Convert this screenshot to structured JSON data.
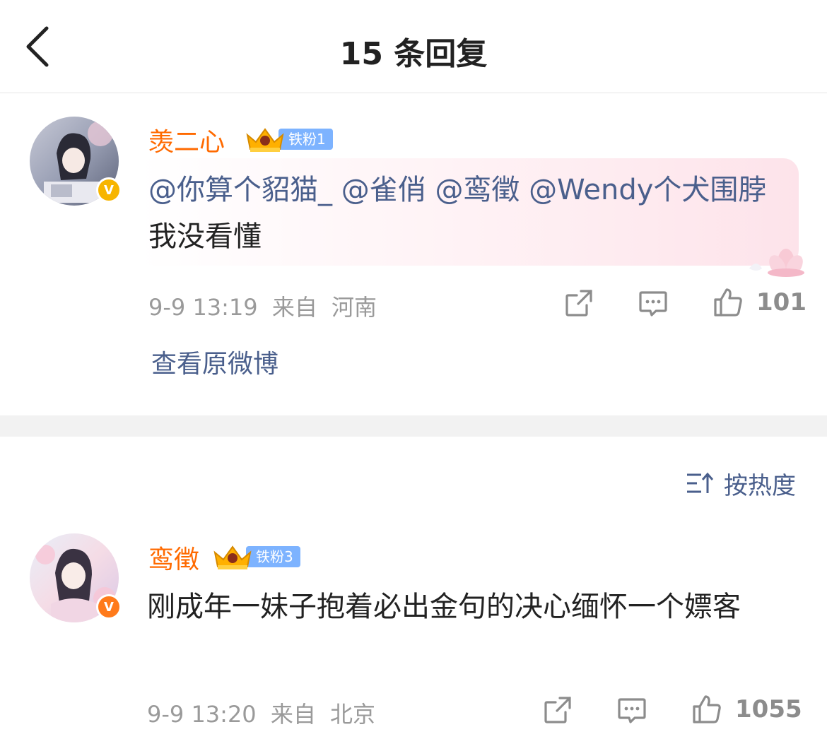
{
  "header": {
    "title": "15 条回复",
    "back_icon": "chevron-left-icon"
  },
  "original_comment": {
    "username": "羡二心",
    "fan_badge": "铁粉1",
    "verified_badge": "V",
    "verified_color": "#f7b500",
    "mentions": [
      "@你算个貂猫_",
      "@雀俏",
      "@鸾徵",
      "@Wendy个犬围脖"
    ],
    "text": "我没看懂",
    "date": "9-9 13:19",
    "source_label": "来自",
    "location": "河南",
    "likes": "101",
    "view_original": "查看原微博"
  },
  "sort": {
    "label": "按热度",
    "icon": "sort-icon"
  },
  "replies": [
    {
      "username": "鸾徵",
      "fan_badge": "铁粉3",
      "verified_badge": "V",
      "verified_color": "#ff7a1a",
      "text": "刚成年一妹子抱着必出金句的决心缅怀一个嫖客",
      "date": "9-9 13:20",
      "source_label": "来自",
      "location": "北京",
      "likes": "1055"
    }
  ],
  "colors": {
    "username": "#ff6a00",
    "mention": "#4a5f8c",
    "fan_badge": "#7db3ff"
  }
}
